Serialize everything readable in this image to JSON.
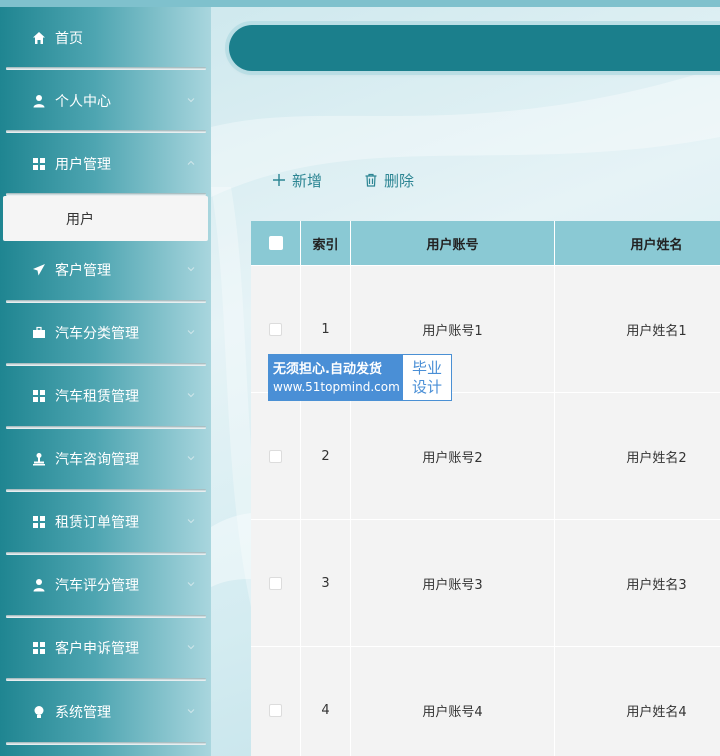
{
  "sidebar": {
    "items": [
      {
        "label": "首页",
        "icon": "home-icon",
        "has_arrow": false
      },
      {
        "label": "个人中心",
        "icon": "user-icon",
        "has_arrow": true
      },
      {
        "label": "用户管理",
        "icon": "grid-icon",
        "has_arrow": true
      },
      {
        "label": "客户管理",
        "icon": "send-icon",
        "has_arrow": true
      },
      {
        "label": "汽车分类管理",
        "icon": "briefcase-icon",
        "has_arrow": true
      },
      {
        "label": "汽车租赁管理",
        "icon": "grid-icon",
        "has_arrow": true
      },
      {
        "label": "汽车咨询管理",
        "icon": "stamp-icon",
        "has_arrow": true
      },
      {
        "label": "租赁订单管理",
        "icon": "grid-icon",
        "has_arrow": true
      },
      {
        "label": "汽车评分管理",
        "icon": "user-icon",
        "has_arrow": true
      },
      {
        "label": "客户申诉管理",
        "icon": "grid-icon",
        "has_arrow": true
      },
      {
        "label": "系统管理",
        "icon": "bulb-icon",
        "has_arrow": true
      }
    ],
    "submenu": {
      "label": "用户"
    }
  },
  "toolbar": {
    "add_label": "新增",
    "delete_label": "删除"
  },
  "table": {
    "headers": {
      "index": "索引",
      "account": "用户账号",
      "name": "用户姓名"
    },
    "rows": [
      {
        "index": "1",
        "account": "用户账号1",
        "name": "用户姓名1"
      },
      {
        "index": "2",
        "account": "用户账号2",
        "name": "用户姓名2"
      },
      {
        "index": "3",
        "account": "用户账号3",
        "name": "用户姓名3"
      },
      {
        "index": "4",
        "account": "用户账号4",
        "name": "用户姓名4"
      }
    ]
  },
  "watermark": {
    "line1": "无须担心.自动发货",
    "line2": "www.51topmind.com",
    "right_line1": "毕业",
    "right_line2": "设计"
  },
  "colors": {
    "accent": "#1b7f8c",
    "header": "#8ac9d4",
    "toolbar_text": "#2c8593"
  }
}
